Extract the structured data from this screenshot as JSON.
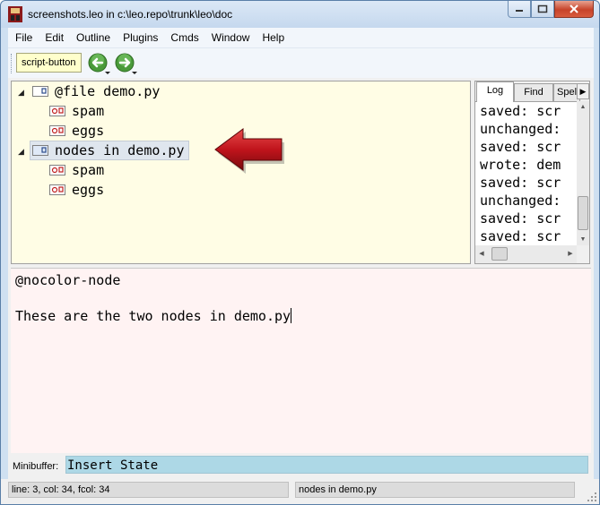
{
  "window": {
    "title": "screenshots.leo in c:\\leo.repo\\trunk\\leo\\doc"
  },
  "menu": [
    "File",
    "Edit",
    "Outline",
    "Plugins",
    "Cmds",
    "Window",
    "Help"
  ],
  "toolbar": {
    "script_button": "script-button",
    "back_icon": "back-arrow-icon",
    "forward_icon": "forward-arrow-icon"
  },
  "outline": {
    "nodes": [
      {
        "label": "@file demo.py",
        "level": 0,
        "expanded": true
      },
      {
        "label": "spam",
        "level": 1
      },
      {
        "label": "eggs",
        "level": 1
      },
      {
        "label": "nodes in demo.py",
        "level": 0,
        "expanded": true,
        "selected": true
      },
      {
        "label": "spam",
        "level": 1
      },
      {
        "label": "eggs",
        "level": 1
      }
    ],
    "annotation_arrow_color": "#c0141c"
  },
  "log": {
    "tabs": [
      "Log",
      "Find",
      "Spell"
    ],
    "active_tab": "Log",
    "lines": [
      "saved: scr",
      "unchanged:",
      "saved: scr",
      "wrote: dem",
      "saved: scr",
      "unchanged:",
      "saved: scr",
      "saved: scr"
    ]
  },
  "body": {
    "lines": [
      "@nocolor-node",
      "",
      "These are the two nodes in demo.py"
    ]
  },
  "minibuffer": {
    "label": "Minibuffer:",
    "value": "Insert State"
  },
  "status": {
    "position": "line: 3, col: 34, fcol: 34",
    "node": "nodes in demo.py"
  },
  "colors": {
    "outline_bg": "#fffde5",
    "body_bg": "#fff3f3",
    "minibuffer_bg": "#add8e6",
    "script_button_bg": "#ffffcc"
  }
}
